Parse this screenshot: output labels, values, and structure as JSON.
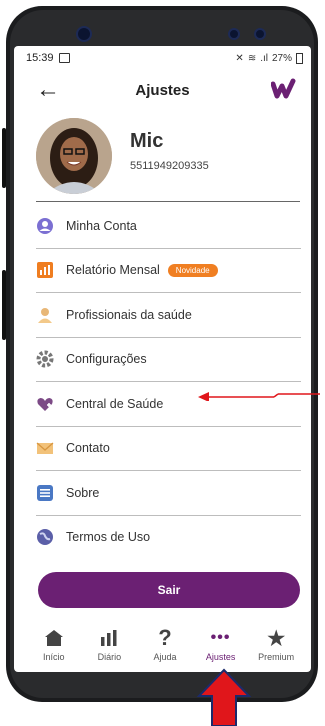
{
  "status": {
    "time": "15:39",
    "battery": "27%"
  },
  "header": {
    "title": "Ajustes"
  },
  "profile": {
    "name": "Mic",
    "phone": "5511949209335"
  },
  "menu": [
    {
      "label": "Minha Conta",
      "icon": "account-icon"
    },
    {
      "label": "Relatório Mensal",
      "icon": "report-icon",
      "badge": "Novidade"
    },
    {
      "label": "Profissionais da saúde",
      "icon": "professional-icon"
    },
    {
      "label": "Configurações",
      "icon": "gear-icon"
    },
    {
      "label": "Central de Saúde",
      "icon": "heart-icon"
    },
    {
      "label": "Contato",
      "icon": "envelope-icon"
    },
    {
      "label": "Sobre",
      "icon": "info-list-icon"
    },
    {
      "label": "Termos de Uso",
      "icon": "globe-icon"
    }
  ],
  "logout_label": "Sair",
  "tabs": [
    {
      "label": "Início",
      "icon": "home-icon"
    },
    {
      "label": "Diário",
      "icon": "bars-icon"
    },
    {
      "label": "Ajuda",
      "icon": "question-icon"
    },
    {
      "label": "Ajustes",
      "icon": "more-icon",
      "active": true
    },
    {
      "label": "Premium",
      "icon": "star-icon"
    }
  ],
  "colors": {
    "brand": "#6b2073",
    "badge": "#f07f22",
    "annotation": "#e0161b"
  }
}
